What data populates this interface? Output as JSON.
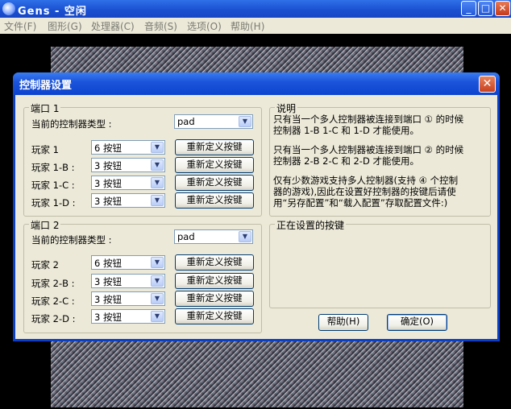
{
  "app": {
    "title": "Gens - 空闲",
    "menu": [
      "文件(F)",
      "图形(G)",
      "处理器(C)",
      "音频(S)",
      "选项(O)",
      "帮助(H)"
    ]
  },
  "dialog": {
    "title": "控制器设置",
    "port1": {
      "legend": "端口 1",
      "type_label": "当前的控制器类型 :",
      "type_value": "pad",
      "players": [
        {
          "label": "玩家 1",
          "value": "6 按钮",
          "button": "重新定义按键"
        },
        {
          "label": "玩家 1-B :",
          "value": "3 按钮",
          "button": "重新定义按键"
        },
        {
          "label": "玩家 1-C :",
          "value": "3 按钮",
          "button": "重新定义按键"
        },
        {
          "label": "玩家 1-D :",
          "value": "3 按钮",
          "button": "重新定义按键"
        }
      ]
    },
    "port2": {
      "legend": "端口 2",
      "type_label": "当前的控制器类型 :",
      "type_value": "pad",
      "players": [
        {
          "label": "玩家 2",
          "value": "6 按钮",
          "button": "重新定义按键"
        },
        {
          "label": "玩家 2-B :",
          "value": "3 按钮",
          "button": "重新定义按键"
        },
        {
          "label": "玩家 2-C :",
          "value": "3 按钮",
          "button": "重新定义按键"
        },
        {
          "label": "玩家 2-D :",
          "value": "3 按钮",
          "button": "重新定义按键"
        }
      ]
    },
    "note": {
      "legend": "说明",
      "lines": [
        "只有当一个多人控制器被连接到端口 ① 的时候",
        "控制器 1-B  1-C 和 1-D 才能使用。",
        "只有当一个多人控制器被连接到端口 ② 的时候",
        "控制器 2-B  2-C 和 2-D 才能使用。",
        "仅有少数游戏支持多人控制器(支持 ④ 个控制",
        "器的游戏),因此在设置好控制器的按键后请使",
        "用“另存配置”和“载入配置”存取配置文件:)"
      ]
    },
    "setting": {
      "legend": "正在设置的按键"
    },
    "help_button": "帮助(H)",
    "ok_button": "确定(O)"
  }
}
